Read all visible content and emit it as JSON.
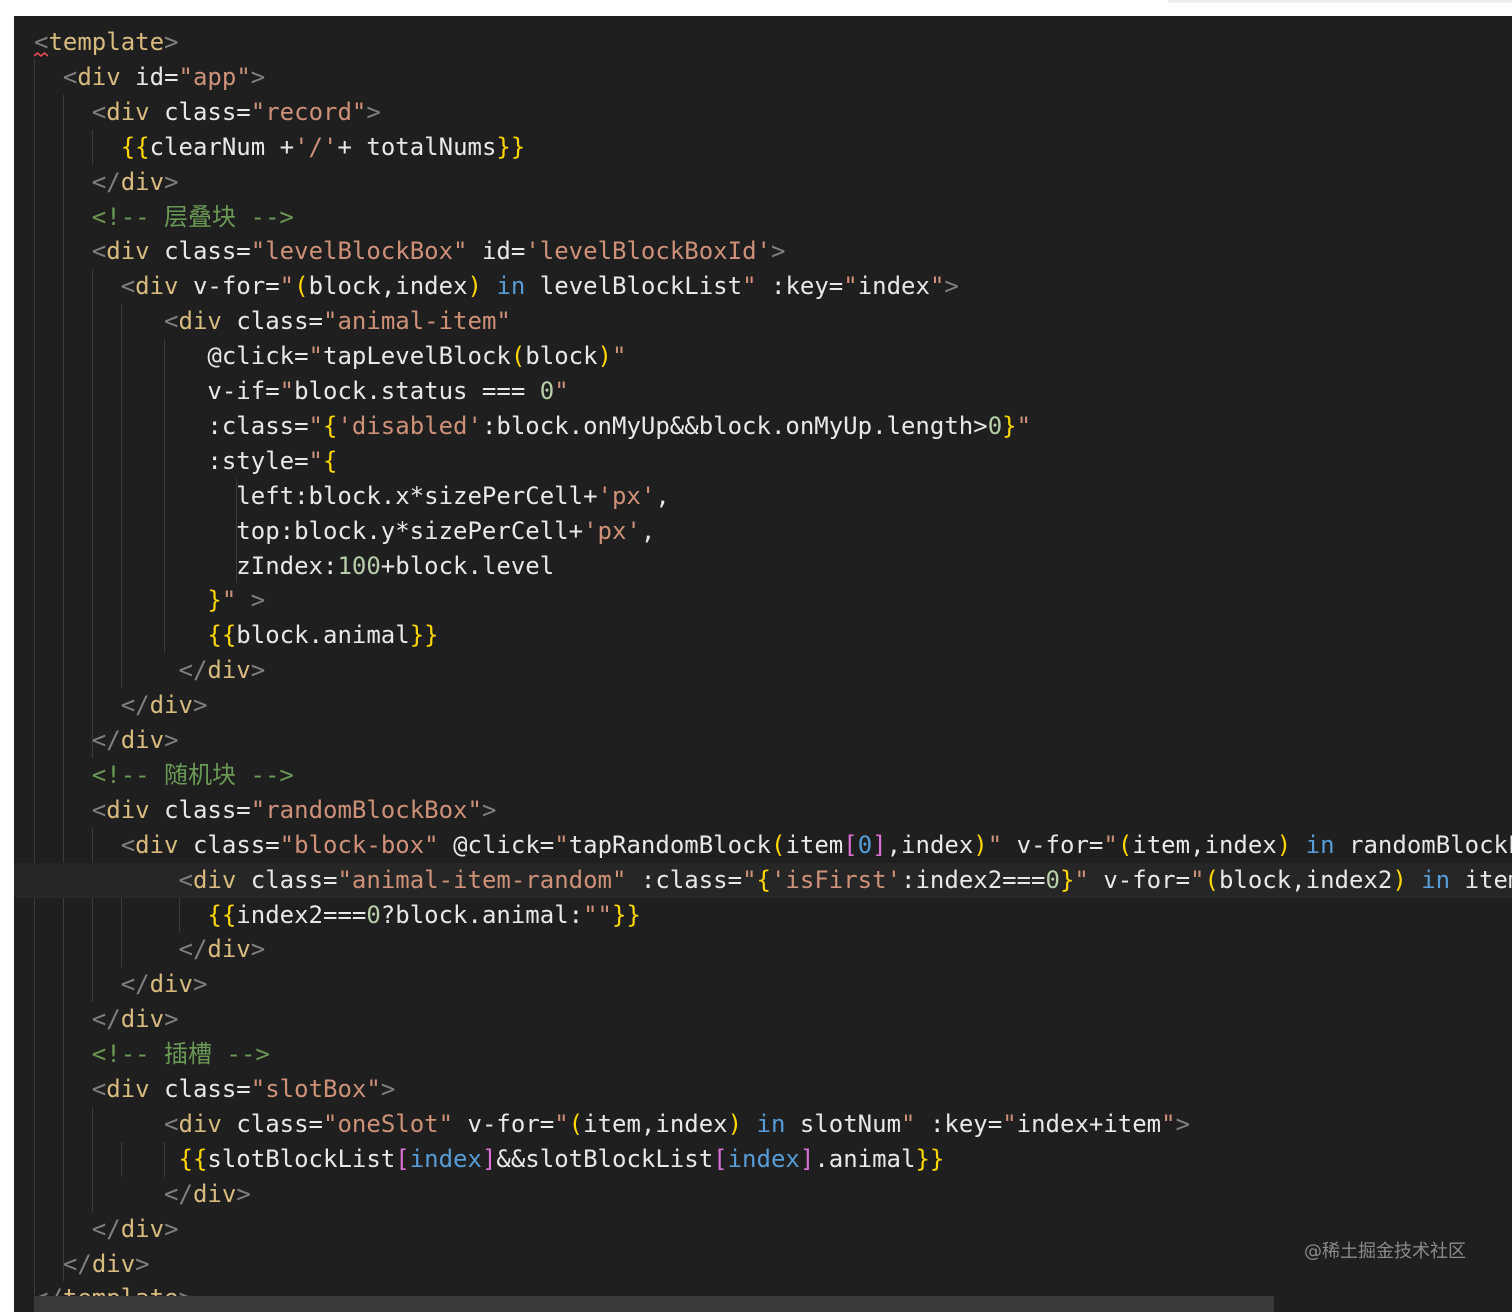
{
  "watermark": "@稀土掘金技术社区",
  "colors": {
    "background": "#1f1f1f",
    "punctuation": "#808080",
    "tag": "#d7ba7d",
    "attribute": "#e8e8e8",
    "string": "#ce9178",
    "mustache": "#ffd700",
    "paren": "#ffd700",
    "bracket": "#da70d6",
    "index": "#569cd6",
    "comment": "#6a9955",
    "keyword": "#569cd6",
    "number": "#b5cea8",
    "text": "#e8e8e8"
  },
  "code_lines": [
    [
      [
        "punc",
        "<"
      ],
      [
        "tag",
        "template"
      ],
      [
        "punc",
        ">"
      ]
    ],
    [
      [
        "txt",
        "  "
      ],
      [
        "punc",
        "<"
      ],
      [
        "tag",
        "div"
      ],
      [
        "txt",
        " "
      ],
      [
        "attr",
        "id="
      ],
      [
        "str",
        "\"app\""
      ],
      [
        "punc",
        ">"
      ]
    ],
    [
      [
        "txt",
        "    "
      ],
      [
        "punc",
        "<"
      ],
      [
        "tag",
        "div"
      ],
      [
        "txt",
        " "
      ],
      [
        "attr",
        "class="
      ],
      [
        "str",
        "\"record\""
      ],
      [
        "punc",
        ">"
      ]
    ],
    [
      [
        "txt",
        "      "
      ],
      [
        "mus",
        "{{"
      ],
      [
        "txt",
        "clearNum +"
      ],
      [
        "str",
        "'/'"
      ],
      [
        "txt",
        "+ totalNums"
      ],
      [
        "mus",
        "}}"
      ]
    ],
    [
      [
        "txt",
        "    "
      ],
      [
        "punc",
        "</"
      ],
      [
        "tag",
        "div"
      ],
      [
        "punc",
        ">"
      ]
    ],
    [
      [
        "txt",
        "    "
      ],
      [
        "com",
        "<!-- 层叠块 -->"
      ]
    ],
    [
      [
        "txt",
        "    "
      ],
      [
        "punc",
        "<"
      ],
      [
        "tag",
        "div"
      ],
      [
        "txt",
        " "
      ],
      [
        "attr",
        "class="
      ],
      [
        "str",
        "\"levelBlockBox\""
      ],
      [
        "txt",
        " "
      ],
      [
        "attr",
        "id="
      ],
      [
        "str",
        "'levelBlockBoxId'"
      ],
      [
        "punc",
        ">"
      ]
    ],
    [
      [
        "txt",
        "      "
      ],
      [
        "punc",
        "<"
      ],
      [
        "tag",
        "div"
      ],
      [
        "txt",
        " "
      ],
      [
        "attr",
        "v-for="
      ],
      [
        "str",
        "\""
      ],
      [
        "par",
        "("
      ],
      [
        "txt",
        "block,index"
      ],
      [
        "par",
        ")"
      ],
      [
        "txt",
        " "
      ],
      [
        "kw",
        "in"
      ],
      [
        "txt",
        " levelBlockList"
      ],
      [
        "str",
        "\""
      ],
      [
        "txt",
        " "
      ],
      [
        "attr",
        ":key="
      ],
      [
        "str",
        "\""
      ],
      [
        "txt",
        "index"
      ],
      [
        "str",
        "\""
      ],
      [
        "punc",
        ">"
      ]
    ],
    [
      [
        "txt",
        "         "
      ],
      [
        "punc",
        "<"
      ],
      [
        "tag",
        "div"
      ],
      [
        "txt",
        " "
      ],
      [
        "attr",
        "class="
      ],
      [
        "str",
        "\"animal-item\""
      ]
    ],
    [
      [
        "txt",
        "            "
      ],
      [
        "attr",
        "@click="
      ],
      [
        "str",
        "\""
      ],
      [
        "txt",
        "tapLevelBlock"
      ],
      [
        "par",
        "("
      ],
      [
        "txt",
        "block"
      ],
      [
        "par",
        ")"
      ],
      [
        "str",
        "\""
      ]
    ],
    [
      [
        "txt",
        "            "
      ],
      [
        "attr",
        "v-if="
      ],
      [
        "str",
        "\""
      ],
      [
        "txt",
        "block.status === "
      ],
      [
        "num",
        "0"
      ],
      [
        "str",
        "\""
      ]
    ],
    [
      [
        "txt",
        "            "
      ],
      [
        "attr",
        ":class="
      ],
      [
        "str",
        "\""
      ],
      [
        "par",
        "{"
      ],
      [
        "str",
        "'disabled'"
      ],
      [
        "txt",
        ":block.onMyUp&&block.onMyUp.length>"
      ],
      [
        "num",
        "0"
      ],
      [
        "par",
        "}"
      ],
      [
        "str",
        "\""
      ]
    ],
    [
      [
        "txt",
        "            "
      ],
      [
        "attr",
        ":style="
      ],
      [
        "str",
        "\""
      ],
      [
        "par",
        "{"
      ]
    ],
    [
      [
        "txt",
        "              left:block.x*sizePerCell+"
      ],
      [
        "str",
        "'px'"
      ],
      [
        "txt",
        ","
      ]
    ],
    [
      [
        "txt",
        "              top:block.y*sizePerCell+"
      ],
      [
        "str",
        "'px'"
      ],
      [
        "txt",
        ","
      ]
    ],
    [
      [
        "txt",
        "              zIndex:"
      ],
      [
        "num",
        "100"
      ],
      [
        "txt",
        "+block.level"
      ]
    ],
    [
      [
        "txt",
        "            "
      ],
      [
        "par",
        "}"
      ],
      [
        "str",
        "\""
      ],
      [
        "txt",
        " "
      ],
      [
        "punc",
        ">"
      ]
    ],
    [
      [
        "txt",
        "            "
      ],
      [
        "mus",
        "{{"
      ],
      [
        "txt",
        "block.animal"
      ],
      [
        "mus",
        "}}"
      ]
    ],
    [
      [
        "txt",
        "          "
      ],
      [
        "punc",
        "</"
      ],
      [
        "tag",
        "div"
      ],
      [
        "punc",
        ">"
      ]
    ],
    [
      [
        "txt",
        "      "
      ],
      [
        "punc",
        "</"
      ],
      [
        "tag",
        "div"
      ],
      [
        "punc",
        ">"
      ]
    ],
    [
      [
        "txt",
        "    "
      ],
      [
        "punc",
        "</"
      ],
      [
        "tag",
        "div"
      ],
      [
        "punc",
        ">"
      ]
    ],
    [
      [
        "txt",
        "    "
      ],
      [
        "com",
        "<!-- 随机块 -->"
      ]
    ],
    [
      [
        "txt",
        "    "
      ],
      [
        "punc",
        "<"
      ],
      [
        "tag",
        "div"
      ],
      [
        "txt",
        " "
      ],
      [
        "attr",
        "class="
      ],
      [
        "str",
        "\"randomBlockBox\""
      ],
      [
        "punc",
        ">"
      ]
    ],
    [
      [
        "txt",
        "      "
      ],
      [
        "punc",
        "<"
      ],
      [
        "tag",
        "div"
      ],
      [
        "txt",
        " "
      ],
      [
        "attr",
        "class="
      ],
      [
        "str",
        "\"block-box\""
      ],
      [
        "txt",
        " "
      ],
      [
        "attr",
        "@click="
      ],
      [
        "str",
        "\""
      ],
      [
        "txt",
        "tapRandomBlock"
      ],
      [
        "par",
        "("
      ],
      [
        "txt",
        "item"
      ],
      [
        "brk",
        "["
      ],
      [
        "idx",
        "0"
      ],
      [
        "brk",
        "]"
      ],
      [
        "txt",
        ",index"
      ],
      [
        "par",
        ")"
      ],
      [
        "str",
        "\""
      ],
      [
        "txt",
        " "
      ],
      [
        "attr",
        "v-for="
      ],
      [
        "str",
        "\""
      ],
      [
        "par",
        "("
      ],
      [
        "txt",
        "item,index"
      ],
      [
        "par",
        ")"
      ],
      [
        "txt",
        " "
      ],
      [
        "kw",
        "in"
      ],
      [
        "txt",
        " randomBlockLis"
      ]
    ],
    [
      [
        "txt",
        "          "
      ],
      [
        "punc",
        "<"
      ],
      [
        "tag",
        "div"
      ],
      [
        "txt",
        " "
      ],
      [
        "attr",
        "class="
      ],
      [
        "str",
        "\"animal-item-random\""
      ],
      [
        "txt",
        " "
      ],
      [
        "attr",
        ":class="
      ],
      [
        "str",
        "\""
      ],
      [
        "par",
        "{"
      ],
      [
        "str",
        "'isFirst'"
      ],
      [
        "txt",
        ":index2==="
      ],
      [
        "num",
        "0"
      ],
      [
        "par",
        "}"
      ],
      [
        "str",
        "\""
      ],
      [
        "txt",
        " "
      ],
      [
        "attr",
        "v-for="
      ],
      [
        "str",
        "\""
      ],
      [
        "par",
        "("
      ],
      [
        "txt",
        "block,index2"
      ],
      [
        "par",
        ")"
      ],
      [
        "txt",
        " "
      ],
      [
        "kw",
        "in"
      ],
      [
        "txt",
        " item"
      ],
      [
        "str",
        "\""
      ]
    ],
    [
      [
        "txt",
        "            "
      ],
      [
        "mus",
        "{{"
      ],
      [
        "txt",
        "index2==="
      ],
      [
        "num",
        "0"
      ],
      [
        "txt",
        "?block.animal:"
      ],
      [
        "str",
        "\"\""
      ],
      [
        "mus",
        "}}"
      ]
    ],
    [
      [
        "txt",
        "          "
      ],
      [
        "punc",
        "</"
      ],
      [
        "tag",
        "div"
      ],
      [
        "punc",
        ">"
      ]
    ],
    [
      [
        "txt",
        "      "
      ],
      [
        "punc",
        "</"
      ],
      [
        "tag",
        "div"
      ],
      [
        "punc",
        ">"
      ]
    ],
    [
      [
        "txt",
        "    "
      ],
      [
        "punc",
        "</"
      ],
      [
        "tag",
        "div"
      ],
      [
        "punc",
        ">"
      ]
    ],
    [
      [
        "txt",
        "    "
      ],
      [
        "com",
        "<!-- 插槽 -->"
      ]
    ],
    [
      [
        "txt",
        "    "
      ],
      [
        "punc",
        "<"
      ],
      [
        "tag",
        "div"
      ],
      [
        "txt",
        " "
      ],
      [
        "attr",
        "class="
      ],
      [
        "str",
        "\"slotBox\""
      ],
      [
        "punc",
        ">"
      ]
    ],
    [
      [
        "txt",
        "         "
      ],
      [
        "punc",
        "<"
      ],
      [
        "tag",
        "div"
      ],
      [
        "txt",
        " "
      ],
      [
        "attr",
        "class="
      ],
      [
        "str",
        "\"oneSlot\""
      ],
      [
        "txt",
        " "
      ],
      [
        "attr",
        "v-for="
      ],
      [
        "str",
        "\""
      ],
      [
        "par",
        "("
      ],
      [
        "txt",
        "item,index"
      ],
      [
        "par",
        ")"
      ],
      [
        "txt",
        " "
      ],
      [
        "kw",
        "in"
      ],
      [
        "txt",
        " slotNum"
      ],
      [
        "str",
        "\""
      ],
      [
        "txt",
        " "
      ],
      [
        "attr",
        ":key="
      ],
      [
        "str",
        "\""
      ],
      [
        "txt",
        "index+item"
      ],
      [
        "str",
        "\""
      ],
      [
        "punc",
        ">"
      ]
    ],
    [
      [
        "txt",
        "          "
      ],
      [
        "mus",
        "{{"
      ],
      [
        "txt",
        "slotBlockList"
      ],
      [
        "brk",
        "["
      ],
      [
        "idx",
        "index"
      ],
      [
        "brk",
        "]"
      ],
      [
        "txt",
        "&&slotBlockList"
      ],
      [
        "brk",
        "["
      ],
      [
        "idx",
        "index"
      ],
      [
        "brk",
        "]"
      ],
      [
        "txt",
        ".animal"
      ],
      [
        "mus",
        "}}"
      ]
    ],
    [
      [
        "txt",
        "         "
      ],
      [
        "punc",
        "</"
      ],
      [
        "tag",
        "div"
      ],
      [
        "punc",
        ">"
      ]
    ],
    [
      [
        "txt",
        "    "
      ],
      [
        "punc",
        "</"
      ],
      [
        "tag",
        "div"
      ],
      [
        "punc",
        ">"
      ]
    ],
    [
      [
        "txt",
        "  "
      ],
      [
        "punc",
        "</"
      ],
      [
        "tag",
        "div"
      ],
      [
        "punc",
        ">"
      ]
    ],
    [
      [
        "punc",
        "</"
      ],
      [
        "tag",
        "template"
      ],
      [
        "punc",
        ">"
      ]
    ]
  ]
}
